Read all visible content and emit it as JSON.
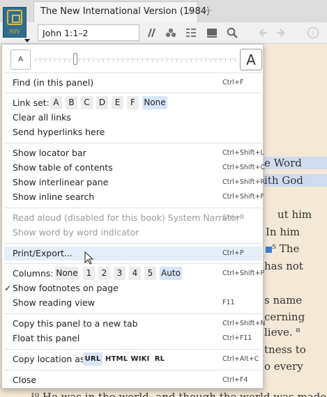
{
  "tab": {
    "book_code": "NIV",
    "title": "The New International Version (1984)",
    "close_glyph": "×",
    "add_glyph": "+"
  },
  "toolbar": {
    "location": "John 1:1–2",
    "icons": [
      "parallel-icon",
      "people-icon",
      "interlinear-icon",
      "panel-icon",
      "search-icon",
      "back-icon",
      "forward-icon",
      "info-icon"
    ]
  },
  "reader": {
    "lines": [
      {
        "text": "e Word",
        "highlight": true
      },
      {
        "text": "ith God",
        "highlight": true
      },
      {
        "text": "ut him",
        "highlight": false
      },
      {
        "text": "In him",
        "highlight": false
      },
      {
        "text": "⁵ The",
        "highlight": false
      },
      {
        "text": "has not",
        "highlight": false
      },
      {
        "text": "s name",
        "highlight": false
      },
      {
        "text": "cerning",
        "highlight": false
      },
      {
        "text": "lieve. ⁸",
        "highlight": false
      },
      {
        "text": "tness to",
        "highlight": false
      },
      {
        "text": "o every",
        "highlight": false
      },
      {
        "text": "¹⁰ He was in the world, and though the world was made",
        "highlight": false
      }
    ]
  },
  "menu": {
    "zoom": {
      "small_label": "A",
      "large_label": "A",
      "level_fraction": 0.2
    },
    "find": {
      "label": "Find (in this panel)",
      "shortcut": "Ctrl+F"
    },
    "link_set": {
      "label": "Link set:",
      "options": [
        "A",
        "B",
        "C",
        "D",
        "E",
        "F",
        "None"
      ],
      "selected": "None"
    },
    "clear_links": {
      "label": "Clear all links"
    },
    "send_links": {
      "label": "Send hyperlinks here"
    },
    "locator_bar": {
      "label": "Show locator bar",
      "shortcut": "Ctrl+Shift+L"
    },
    "toc": {
      "label": "Show table of contents",
      "shortcut": "Ctrl+Shift+C"
    },
    "interlinear": {
      "label": "Show interlinear pane",
      "shortcut": "Ctrl+Shift+R"
    },
    "inline_search": {
      "label": "Show inline search",
      "shortcut": "Ctrl+Shift+F"
    },
    "read_aloud": {
      "label": "Read aloud (disabled for this book)",
      "voice": "System Narrator",
      "shortcut": "Ctrl+R"
    },
    "word_indicator": {
      "label": "Show word by word indicator"
    },
    "print": {
      "label": "Print/Export...",
      "shortcut": "Ctrl+P"
    },
    "columns": {
      "label": "Columns:",
      "options": [
        "None",
        "1",
        "2",
        "3",
        "4",
        "5",
        "Auto"
      ],
      "selected": "Auto",
      "shortcut": "Ctrl+Shift+P"
    },
    "footnotes": {
      "label": "Show footnotes on page",
      "checked": true
    },
    "reading_view": {
      "label": "Show reading view",
      "shortcut": "F11"
    },
    "copy_panel": {
      "label": "Copy this panel to a new tab",
      "shortcut": "Ctrl+Shift+N"
    },
    "float_panel": {
      "label": "Float this panel",
      "shortcut": "Ctrl+F11"
    },
    "copy_location": {
      "label": "Copy location as:",
      "options": [
        "URL",
        "HTML",
        "WIKI",
        "RL"
      ],
      "selected": "URL",
      "shortcut": "Ctrl+Alt+C"
    },
    "close": {
      "label": "Close",
      "shortcut": "Ctrl+F4"
    }
  }
}
